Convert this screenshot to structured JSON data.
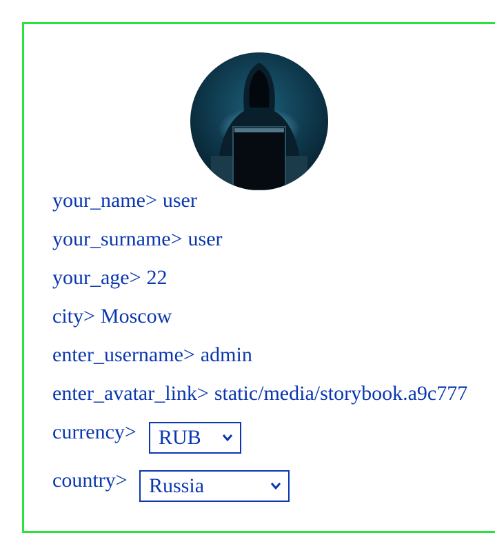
{
  "profile": {
    "avatar_icon": "hacker-avatar-icon",
    "fields": {
      "name": {
        "label": "your_name>",
        "value": "user"
      },
      "surname": {
        "label": "your_surname>",
        "value": "user"
      },
      "age": {
        "label": "your_age>",
        "value": "22"
      },
      "city": {
        "label": "city>",
        "value": "Moscow"
      },
      "username": {
        "label": "enter_username>",
        "value": "admin"
      },
      "avatar_link": {
        "label": "enter_avatar_link>",
        "value": "static/media/storybook.a9c777"
      }
    },
    "currency": {
      "label": "currency>",
      "selected": "RUB"
    },
    "country": {
      "label": "country>",
      "selected": "Russia"
    }
  },
  "colors": {
    "border": "#27e43a",
    "text": "#0a37b0"
  }
}
